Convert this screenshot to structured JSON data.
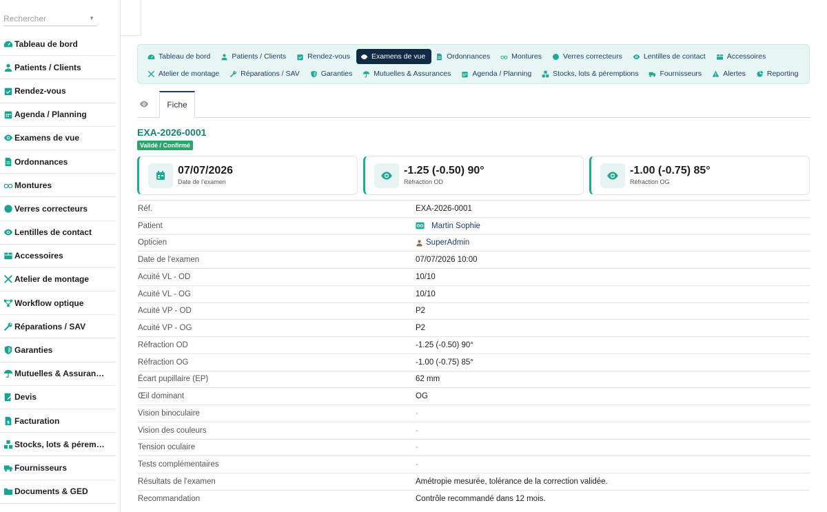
{
  "search": {
    "placeholder": "Rechercher"
  },
  "sidebar": {
    "items": [
      {
        "label": "Tableau de bord",
        "icon": "dashboard-icon"
      },
      {
        "label": "Patients / Clients",
        "icon": "user-icon"
      },
      {
        "label": "Rendez-vous",
        "icon": "calendar-check-icon"
      },
      {
        "label": "Agenda / Planning",
        "icon": "calendar-icon"
      },
      {
        "label": "Examens de vue",
        "icon": "eye-icon"
      },
      {
        "label": "Ordonnances",
        "icon": "file-icon"
      },
      {
        "label": "Montures",
        "icon": "glasses-icon"
      },
      {
        "label": "Verres correcteurs",
        "icon": "circle-icon"
      },
      {
        "label": "Lentilles de contact",
        "icon": "eye-icon"
      },
      {
        "label": "Accessoires",
        "icon": "box-icon"
      },
      {
        "label": "Atelier de montage",
        "icon": "tools-icon"
      },
      {
        "label": "Workflow optique",
        "icon": "workflow-icon"
      },
      {
        "label": "Réparations / SAV",
        "icon": "wrench-icon"
      },
      {
        "label": "Garanties",
        "icon": "shield-icon"
      },
      {
        "label": "Mutuelles & Assuran…",
        "icon": "umbrella-icon"
      },
      {
        "label": "Devis",
        "icon": "edit-icon"
      },
      {
        "label": "Facturation",
        "icon": "invoice-icon"
      },
      {
        "label": "Stocks, lots & pérem…",
        "icon": "boxes-icon"
      },
      {
        "label": "Fournisseurs",
        "icon": "truck-icon"
      },
      {
        "label": "Documents & GED",
        "icon": "folder-icon"
      }
    ]
  },
  "nav": {
    "row1": [
      {
        "label": "Tableau de bord",
        "icon": "dashboard-icon"
      },
      {
        "label": "Patients / Clients",
        "icon": "user-icon"
      },
      {
        "label": "Rendez-vous",
        "icon": "calendar-check-icon"
      },
      {
        "label": "Examens de vue",
        "icon": "eye-icon",
        "active": true
      },
      {
        "label": "Ordonnances",
        "icon": "file-icon"
      },
      {
        "label": "Montures",
        "icon": "glasses-icon"
      },
      {
        "label": "Verres correcteurs",
        "icon": "circle-icon"
      },
      {
        "label": "Lentilles de contact",
        "icon": "eye-icon"
      },
      {
        "label": "Accessoires",
        "icon": "box-icon"
      }
    ],
    "row2": [
      {
        "label": "Atelier de montage",
        "icon": "tools-icon"
      },
      {
        "label": "Réparations / SAV",
        "icon": "wrench-icon"
      },
      {
        "label": "Garanties",
        "icon": "shield-icon"
      },
      {
        "label": "Mutuelles & Assurances",
        "icon": "umbrella-icon"
      },
      {
        "label": "Agenda / Planning",
        "icon": "calendar-icon"
      },
      {
        "label": "Stocks, lots & péremptions",
        "icon": "boxes-icon"
      },
      {
        "label": "Fournisseurs",
        "icon": "truck-icon"
      },
      {
        "label": "Alertes",
        "icon": "warning-icon"
      },
      {
        "label": "Reporting",
        "icon": "pie-chart-icon"
      }
    ]
  },
  "tabs": {
    "fiche": "Fiche"
  },
  "record": {
    "title": "EXA-2026-0001",
    "status": "Validé / Confirmé"
  },
  "cards": [
    {
      "value": "07/07/2026",
      "label": "Date de l'examen",
      "icon": "calendar-icon"
    },
    {
      "value": "-1.25 (-0.50) 90°",
      "label": "Réfraction OD",
      "icon": "eye-icon"
    },
    {
      "value": "-1.00 (-0.75) 85°",
      "label": "Réfraction OG",
      "icon": "eye-icon"
    }
  ],
  "details": [
    {
      "key": "Réf.",
      "value": "EXA-2026-0001"
    },
    {
      "key": "Patient",
      "value": "Martin Sophie",
      "link": true,
      "icon": "glasses-badge-icon"
    },
    {
      "key": "Opticien",
      "value": "SuperAdmin",
      "link": true,
      "icon": "user-icon"
    },
    {
      "key": "Date de l'examen",
      "value": "07/07/2026 10:00"
    },
    {
      "key": "Acuité VL - OD",
      "value": "10/10"
    },
    {
      "key": "Acuité VL - OG",
      "value": "10/10"
    },
    {
      "key": "Acuité VP - OD",
      "value": "P2"
    },
    {
      "key": "Acuité VP - OG",
      "value": "P2"
    },
    {
      "key": "Réfraction OD",
      "value": "-1.25 (-0.50) 90°"
    },
    {
      "key": "Réfraction OG",
      "value": "-1.00 (-0.75) 85°"
    },
    {
      "key": "Écart pupillaire (EP)",
      "value": "62 mm"
    },
    {
      "key": "Œil dominant",
      "value": "OG"
    },
    {
      "key": "Vision binoculaire",
      "value": "-",
      "muted": true
    },
    {
      "key": "Vision des couleurs",
      "value": "-",
      "muted": true
    },
    {
      "key": "Tension oculaire",
      "value": "-",
      "muted": true
    },
    {
      "key": "Tests complémentaires",
      "value": "-",
      "muted": true
    },
    {
      "key": "Résultats de l'examen",
      "value": "Amétropie mesurée, tolérance de la correction validée."
    },
    {
      "key": "Recommandation",
      "value": "Contrôle recommandé dans 12 mois."
    }
  ],
  "colors": {
    "accent": "#22a898",
    "nav_bg": "#e8f6f3",
    "active_nav": "#112b44",
    "link": "#1d3c6e",
    "badge": "#2ca56d"
  }
}
